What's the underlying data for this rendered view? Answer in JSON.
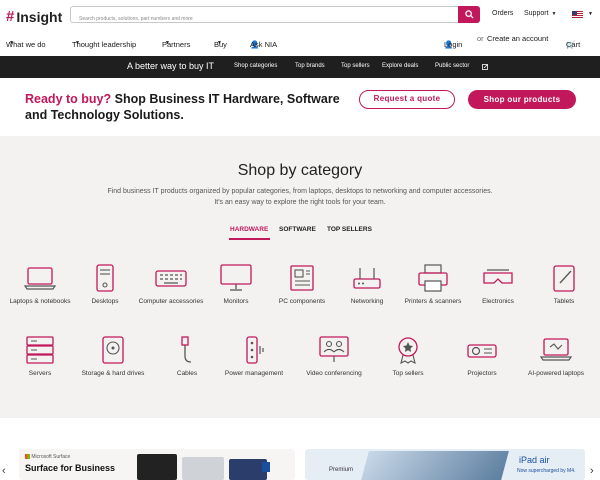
{
  "header": {
    "logo_text": "Insight",
    "search_placeholder": "Search products, solutions, part numbers and more",
    "orders": "Orders",
    "support": "Support",
    "region": "US"
  },
  "nav": {
    "items": [
      "What we do",
      "Thought leadership",
      "Partners",
      "Buy",
      "Ask NIA"
    ],
    "login": "Login",
    "or": "or",
    "create_account": "Create an account",
    "cart": "Cart"
  },
  "strip": {
    "headline": "A better way to buy IT",
    "links": [
      "Shop categories",
      "Top brands",
      "Top sellers",
      "Explore deals",
      "Public sector"
    ]
  },
  "promo": {
    "highlight": "Ready to buy?",
    "text": "Shop Business IT Hardware, Software and Technology Solutions.",
    "quote_button": "Request a quote",
    "shop_button": "Shop our products"
  },
  "category": {
    "title": "Shop by category",
    "desc_line1": "Find business IT products organized by popular categories, from laptops, desktops to networking and computer accessories.",
    "desc_line2": "It's an easy way to explore the right tools for your team.",
    "tabs": [
      "HARDWARE",
      "SOFTWARE",
      "TOP SELLERS"
    ],
    "active_tab": "HARDWARE",
    "row1": [
      {
        "label": "Laptops & notebooks",
        "icon": "laptop-icon"
      },
      {
        "label": "Desktops",
        "icon": "desktop-tower-icon"
      },
      {
        "label": "Computer accessories",
        "icon": "keyboard-icon"
      },
      {
        "label": "Monitors",
        "icon": "monitor-icon"
      },
      {
        "label": "PC components",
        "icon": "circuit-board-icon"
      },
      {
        "label": "Networking",
        "icon": "router-icon"
      },
      {
        "label": "Printers & scanners",
        "icon": "printer-icon"
      },
      {
        "label": "Electronics",
        "icon": "vr-headset-icon"
      },
      {
        "label": "Tablets",
        "icon": "tablet-pen-icon"
      }
    ],
    "row2": [
      {
        "label": "Servers",
        "icon": "server-icon"
      },
      {
        "label": "Storage & hard drives",
        "icon": "hard-drive-icon"
      },
      {
        "label": "Cables",
        "icon": "cable-icon"
      },
      {
        "label": "Power management",
        "icon": "power-strip-icon"
      },
      {
        "label": "Video conferencing",
        "icon": "video-conference-icon"
      },
      {
        "label": "Top sellers",
        "icon": "award-badge-icon"
      },
      {
        "label": "Projectors",
        "icon": "projector-icon"
      },
      {
        "label": "AI-powered laptops",
        "icon": "ai-laptop-icon"
      }
    ]
  },
  "cards": {
    "left_brand": "Microsoft Surface",
    "left_title": "Surface for Business",
    "right_brand": "Premium",
    "right_title": "iPad air",
    "right_sub": "Now supercharged by M4."
  },
  "colors": {
    "accent": "#c2185b",
    "dark_strip": "#1f1f1f",
    "section_bg": "#f3f2f1"
  }
}
